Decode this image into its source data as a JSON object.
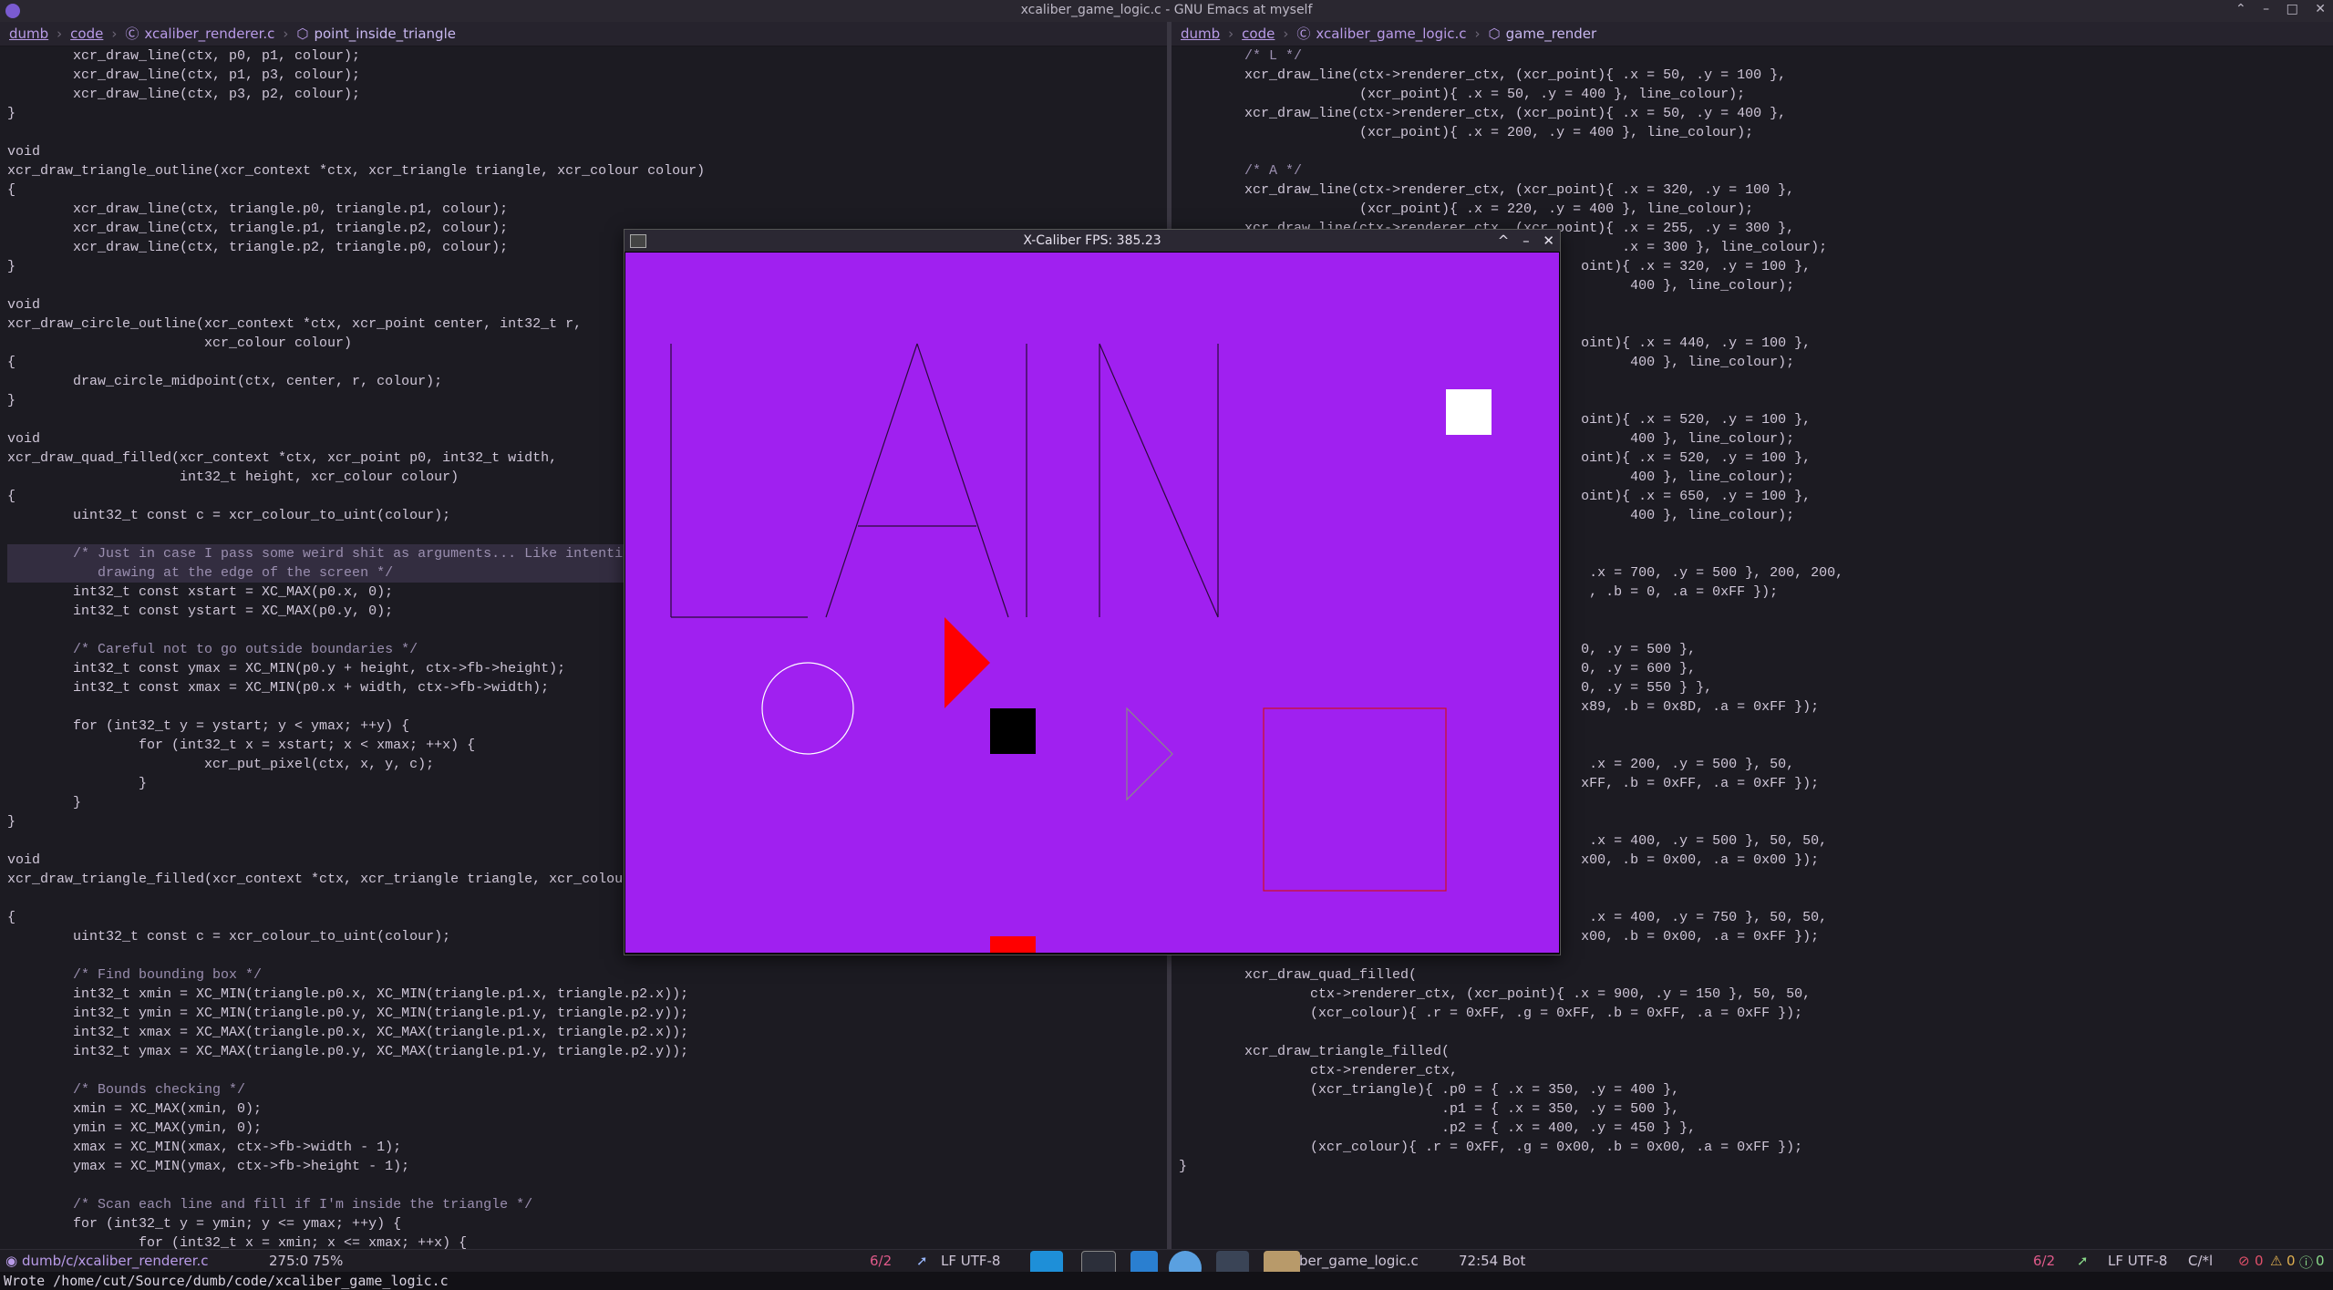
{
  "window_title": "xcaliber_game_logic.c - GNU Emacs at myself",
  "window_buttons": [
    "⌃",
    "–",
    "□",
    "✕"
  ],
  "left_pane": {
    "breadcrumb": [
      "dumb",
      "code",
      "xcaliber_renderer.c",
      "point_inside_triangle"
    ],
    "code_lines": [
      "        xcr_draw_line(ctx, p0, p1, colour);",
      "        xcr_draw_line(ctx, p1, p3, colour);",
      "        xcr_draw_line(ctx, p3, p2, colour);",
      "}",
      "",
      "void",
      "xcr_draw_triangle_outline(xcr_context *ctx, xcr_triangle triangle, xcr_colour colour)",
      "{",
      "        xcr_draw_line(ctx, triangle.p0, triangle.p1, colour);",
      "        xcr_draw_line(ctx, triangle.p1, triangle.p2, colour);",
      "        xcr_draw_line(ctx, triangle.p2, triangle.p0, colour);",
      "}",
      "",
      "void",
      "xcr_draw_circle_outline(xcr_context *ctx, xcr_point center, int32_t r,",
      "                        xcr_colour colour)",
      "{",
      "        draw_circle_midpoint(ctx, center, r, colour);",
      "}",
      "",
      "void",
      "xcr_draw_quad_filled(xcr_context *ctx, xcr_point p0, int32_t width,",
      "                     int32_t height, xcr_colour colour)",
      "{",
      "        uint32_t const c = xcr_colour_to_uint(colour);",
      "",
      "        /* Just in case I pass some weird shit as arguments... Like intenti",
      "           drawing at the edge of the screen */",
      "        int32_t const xstart = XC_MAX(p0.x, 0);",
      "        int32_t const ystart = XC_MAX(p0.y, 0);",
      "",
      "        /* Careful not to go outside boundaries */",
      "        int32_t const ymax = XC_MIN(p0.y + height, ctx->fb->height);",
      "        int32_t const xmax = XC_MIN(p0.x + width, ctx->fb->width);",
      "",
      "        for (int32_t y = ystart; y < ymax; ++y) {",
      "                for (int32_t x = xstart; x < xmax; ++x) {",
      "                        xcr_put_pixel(ctx, x, y, c);",
      "                }",
      "        }",
      "}",
      "",
      "void",
      "xcr_draw_triangle_filled(xcr_context *ctx, xcr_triangle triangle, xcr_colou",
      "",
      "{",
      "        uint32_t const c = xcr_colour_to_uint(colour);",
      "",
      "        /* Find bounding box */",
      "        int32_t xmin = XC_MIN(triangle.p0.x, XC_MIN(triangle.p1.x, triangle.p2.x));",
      "        int32_t ymin = XC_MIN(triangle.p0.y, XC_MIN(triangle.p1.y, triangle.p2.y));",
      "        int32_t xmax = XC_MAX(triangle.p0.x, XC_MAX(triangle.p1.x, triangle.p2.x));",
      "        int32_t ymax = XC_MAX(triangle.p0.y, XC_MAX(triangle.p1.y, triangle.p2.y));",
      "",
      "        /* Bounds checking */",
      "        xmin = XC_MAX(xmin, 0);",
      "        ymin = XC_MAX(ymin, 0);",
      "        xmax = XC_MIN(xmax, ctx->fb->width - 1);",
      "        ymax = XC_MIN(ymax, ctx->fb->height - 1);",
      "",
      "        /* Scan each line and fill if I'm inside the triangle */",
      "        for (int32_t y = ymin; y <= ymax; ++y) {",
      "                for (int32_t x = xmin; x <= xmax; ++x) {"
    ]
  },
  "right_pane": {
    "breadcrumb": [
      "dumb",
      "code",
      "xcaliber_game_logic.c",
      "game_render"
    ],
    "code_lines": [
      "        /* L */",
      "        xcr_draw_line(ctx->renderer_ctx, (xcr_point){ .x = 50, .y = 100 },",
      "                      (xcr_point){ .x = 50, .y = 400 }, line_colour);",
      "        xcr_draw_line(ctx->renderer_ctx, (xcr_point){ .x = 50, .y = 400 },",
      "                      (xcr_point){ .x = 200, .y = 400 }, line_colour);",
      "",
      "        /* A */",
      "        xcr_draw_line(ctx->renderer_ctx, (xcr_point){ .x = 320, .y = 100 },",
      "                      (xcr_point){ .x = 220, .y = 400 }, line_colour);",
      "        xcr_draw_line(ctx->renderer_ctx, (xcr_point){ .x = 255, .y = 300 },",
      "                                                      .x = 300 }, line_colour);",
      "                                                 oint){ .x = 320, .y = 100 },",
      "                                                       400 }, line_colour);",
      "",
      "",
      "                                                 oint){ .x = 440, .y = 100 },",
      "                                                       400 }, line_colour);",
      "",
      "",
      "                                                 oint){ .x = 520, .y = 100 },",
      "                                                       400 }, line_colour);",
      "                                                 oint){ .x = 520, .y = 100 },",
      "                                                       400 }, line_colour);",
      "                                                 oint){ .x = 650, .y = 100 },",
      "                                                       400 }, line_colour);",
      "",
      "",
      "                                                  .x = 700, .y = 500 }, 200, 200,",
      "                                                  , .b = 0, .a = 0xFF });",
      "",
      "",
      "                                                 0, .y = 500 },",
      "                                                 0, .y = 600 },",
      "                                                 0, .y = 550 } },",
      "                                                 x89, .b = 0x8D, .a = 0xFF });",
      "",
      "",
      "                                                  .x = 200, .y = 500 }, 50,",
      "                                                 xFF, .b = 0xFF, .a = 0xFF });",
      "",
      "",
      "                                                  .x = 400, .y = 500 }, 50, 50,",
      "                                                 x00, .b = 0x00, .a = 0x00 });",
      "",
      "",
      "                                                  .x = 400, .y = 750 }, 50, 50,",
      "                                                 x00, .b = 0x00, .a = 0xFF });",
      "",
      "        xcr_draw_quad_filled(",
      "                ctx->renderer_ctx, (xcr_point){ .x = 900, .y = 150 }, 50, 50,",
      "                (xcr_colour){ .r = 0xFF, .g = 0xFF, .b = 0xFF, .a = 0xFF });",
      "",
      "        xcr_draw_triangle_filled(",
      "                ctx->renderer_ctx,",
      "                (xcr_triangle){ .p0 = { .x = 350, .y = 400 },",
      "                                .p1 = { .x = 350, .y = 500 },",
      "                                .p2 = { .x = 400, .y = 450 } },",
      "                (xcr_colour){ .r = 0xFF, .g = 0x00, .b = 0x00, .a = 0xFF });",
      "}"
    ]
  },
  "floating_window": {
    "title": "X-Caliber FPS: 385.23",
    "buttons": [
      "^",
      "–",
      "✕"
    ],
    "canvas_bg": "#a020f0",
    "line_colour": "#2a0a3a"
  },
  "status_left": {
    "file": "dumb/c/xcaliber_renderer.c",
    "position": "275:0 75%",
    "errors": "6/2",
    "encoding": "LF UTF-8"
  },
  "status_right": {
    "file": "ber_game_logic.c",
    "position": "72:54 Bot",
    "errors": "6/2",
    "encoding": "LF UTF-8",
    "mode": "C/*l",
    "counts": [
      "0",
      "0",
      "0"
    ]
  },
  "minibuffer": "Wrote /home/cut/Source/dumb/code/xcaliber_game_logic.c",
  "colors": {
    "accent": "#b99be8",
    "canvas": "#a020f0",
    "red": "#ff0000",
    "white": "#ffffff",
    "black": "#000000"
  }
}
